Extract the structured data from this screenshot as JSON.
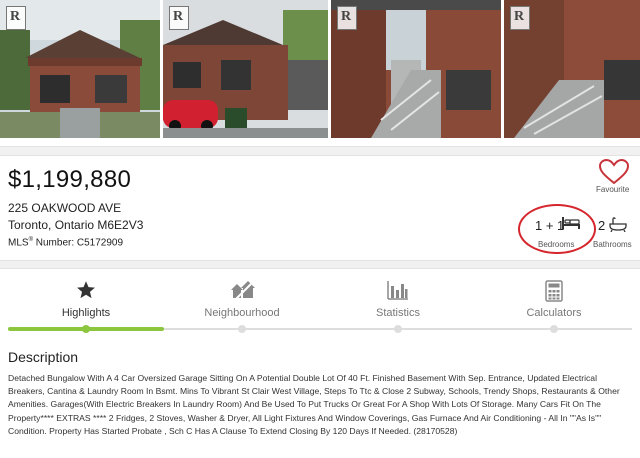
{
  "photos": [
    {
      "name": "photo-1"
    },
    {
      "name": "photo-2"
    },
    {
      "name": "photo-3"
    },
    {
      "name": "photo-4"
    }
  ],
  "listing": {
    "price": "$1,199,880",
    "address": "225 OAKWOOD AVE",
    "city": "Toronto, Ontario M6E2V3",
    "mls_prefix": "MLS",
    "mls_mark": "®",
    "mls_suffix": " Number: C5172909",
    "favourite_label": "Favourite",
    "bedrooms_value": "1 + 1",
    "bedrooms_label": "Bedrooms",
    "bathrooms_value": "2",
    "bathrooms_label": "Bathrooms"
  },
  "tabs": [
    {
      "label": "Highlights",
      "icon": "star-icon",
      "active": true
    },
    {
      "label": "Neighbourhood",
      "icon": "neighbourhood-icon",
      "active": false
    },
    {
      "label": "Statistics",
      "icon": "bar-chart-icon",
      "active": false
    },
    {
      "label": "Calculators",
      "icon": "calculator-icon",
      "active": false
    }
  ],
  "description": {
    "title": "Description",
    "body": "Detached Bungalow With A 4 Car Oversized Garage Sitting On A Potential Double Lot Of 40 Ft. Finished Basement With Sep. Entrance, Updated Electrical Breakers, Cantina & Laundry Room In Bsmt. Mins To Vibrant St Clair West Village, Steps To Ttc & Close 2 Subway, Schools, Trendy Shops, Restaurants & Other Amenities. Garages(With Electric Breakers In Laundry Room) And Be Used To Put Trucks Or Great For A Shop With Lots Of Storage. Many Cars Fit On The Property**** EXTRAS **** 2 Fridges, 2 Stoves, Washer & Dryer, All Light Fixtures And Window Coverings, Gas Furnace And Air Conditioning - All In \"\"As Is\"\" Condition. Property Has Started Probate , Sch C Has A Clause To Extend Closing By 120 Days If Needed. (28170528)"
  },
  "colors": {
    "accent_green": "#8cc63f",
    "heart_red": "#c8333a",
    "highlight_circle": "#d4262c"
  }
}
